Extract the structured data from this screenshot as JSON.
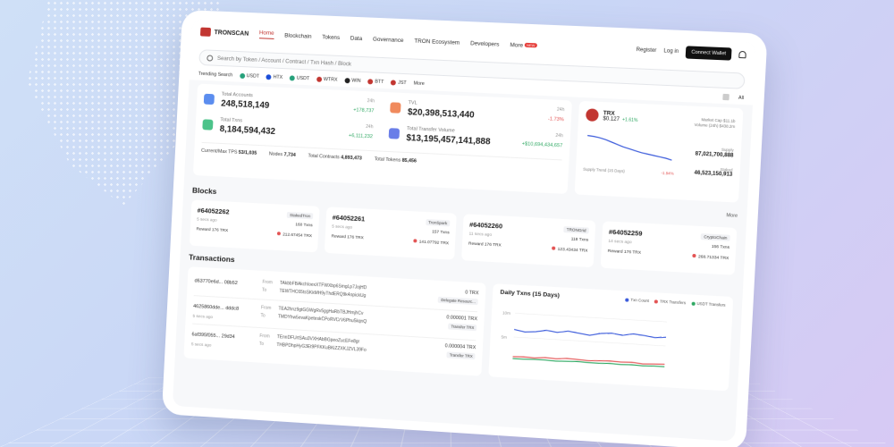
{
  "header": {
    "logo_text": "TRONSCAN",
    "nav": [
      {
        "label": "Home",
        "active": true
      },
      {
        "label": "Blockchain"
      },
      {
        "label": "Tokens"
      },
      {
        "label": "Data"
      },
      {
        "label": "Governance"
      },
      {
        "label": "TRON Ecosystem"
      },
      {
        "label": "Developers"
      },
      {
        "label": "More",
        "badge": "NEW"
      }
    ],
    "register": "Register",
    "login": "Log in",
    "connect_wallet": "Connect Wallet"
  },
  "search": {
    "placeholder": "Search by Token / Account / Contract / Txn Hash / Block",
    "trending_label": "Trending Search",
    "trending": [
      {
        "label": "USDT",
        "color": "#26a17b"
      },
      {
        "label": "HTX",
        "color": "#1b4ed8"
      },
      {
        "label": "USDT",
        "color": "#26a17b"
      },
      {
        "label": "WTRX",
        "color": "#c23631"
      },
      {
        "label": "WIN",
        "color": "#222222"
      },
      {
        "label": "BTT",
        "color": "#c23631"
      },
      {
        "label": "JST",
        "color": "#c23631"
      }
    ],
    "more": "More",
    "all": "All"
  },
  "stats": {
    "total_accounts": {
      "label": "Total Accounts",
      "value": "248,518,149",
      "period": "24h",
      "change": "+178,737"
    },
    "tvl": {
      "label": "TVL",
      "value": "$20,398,513,440",
      "period": "24h",
      "change": "-1.73%"
    },
    "total_txns": {
      "label": "Total Txns",
      "value": "8,184,594,432",
      "period": "24h",
      "change": "+6,111,232"
    },
    "total_transfer_volume": {
      "label": "Total Transfer Volume",
      "value": "$13,195,457,141,888",
      "period": "24h",
      "change": "+$10,694,434,657"
    },
    "footer": {
      "tps_label": "Current/Max TPS",
      "tps_value": "53/1,035",
      "nodes_label": "Nodes",
      "nodes_value": "7,734",
      "contracts_label": "Total Contracts",
      "contracts_value": "4,893,473",
      "tokens_label": "Total Tokens",
      "tokens_value": "85,456"
    }
  },
  "trx": {
    "name": "TRX",
    "price": "$0.127",
    "change": "+1.61%",
    "market_cap": "Market Cap $11.1b",
    "volume": "Volume (24h) $438.2m",
    "supply_label": "Supply",
    "supply_value": "87,021,700,888",
    "staked_label": "Staked",
    "staked_value": "46,523,150,913",
    "trend_label": "Supply Trend (15 Days)",
    "trend_change": "-1.94%",
    "trend_points": [
      100,
      99,
      97,
      94,
      90,
      86,
      82,
      79,
      76,
      73,
      71,
      69,
      67,
      65,
      62
    ]
  },
  "blocks": {
    "title": "Blocks",
    "more": "More",
    "items": [
      {
        "number": "#64052262",
        "producer": "StakedTron",
        "time": "5 secs ago",
        "txns": "160 Txns",
        "reward": "Reward 176 TRX",
        "burn": "212.67454 TRX"
      },
      {
        "number": "#64052261",
        "producer": "TronSpark",
        "time": "5 secs ago",
        "txns": "157 Txns",
        "reward": "Reward 176 TRX",
        "burn": "141.07792 TRX"
      },
      {
        "number": "#64052260",
        "producer": "TRONGrid",
        "time": "11 secs ago",
        "txns": "118 Txns",
        "reward": "Reward 176 TRX",
        "burn": "123.43434 TRX"
      },
      {
        "number": "#64052259",
        "producer": "CryptoChain",
        "time": "14 secs ago",
        "txns": "156 Txns",
        "reward": "Reward 176 TRX",
        "burn": "268.71334 TRX"
      }
    ]
  },
  "transactions": {
    "title": "Transactions",
    "from_label": "From",
    "to_label": "To",
    "items": [
      {
        "hash": "d63770e6d... 08b52",
        "time": "",
        "from": "TAkbbFBAkchIoexXTFWXbp6SmgLp7JojHD",
        "to": "TEWTHC65tsSKkMH9yThdERQ9k4opickUg",
        "amount": "0 TRX",
        "type": "Delegate Resourc..."
      },
      {
        "hash": "4625860dde... dddc8",
        "time": "5 secs ago",
        "from": "TEA2hnz9gtGGWgRv5ggHaRbTBJHmjhCv",
        "to": "TMDYhw5evaKpeteskCPoRVCrV6Phu5kqnQ",
        "amount": "0.000001 TRX",
        "type": "Transfer TRX"
      },
      {
        "hash": "6af395f055... 29d34",
        "time": "5 secs ago",
        "from": "TEnnDFUrtSAu3VXHAbBGpeoZucEFe8gr",
        "to": "THBPDhpHyG3Et9PFKKuBKiZZXKJZVL39Fo",
        "amount": "0.000004 TRX",
        "type": "Transfer TRX"
      }
    ]
  },
  "daily": {
    "title": "Daily Txns (15 Days)",
    "legend": [
      "Txn Count",
      "TRX Transfers",
      "USDT Transfers"
    ],
    "y_ticks": [
      "10m",
      "5m"
    ],
    "txn_count": [
      6.6,
      6.2,
      6.4,
      6.8,
      6.5,
      6.9,
      6.6,
      6.3,
      6.8,
      7.0,
      6.7,
      7.1,
      6.9,
      6.6,
      6.8
    ],
    "trx_transfers": [
      0.9,
      1.0,
      0.9,
      1.1,
      1.0,
      1.2,
      1.1,
      1.0,
      1.1,
      1.2,
      1.1,
      1.2,
      1.0,
      1.1,
      1.2
    ],
    "usdt_transfers": [
      0.5,
      0.5,
      0.6,
      0.6,
      0.5,
      0.6,
      0.7,
      0.6,
      0.6,
      0.7,
      0.6,
      0.7,
      0.6,
      0.7,
      0.7
    ]
  }
}
